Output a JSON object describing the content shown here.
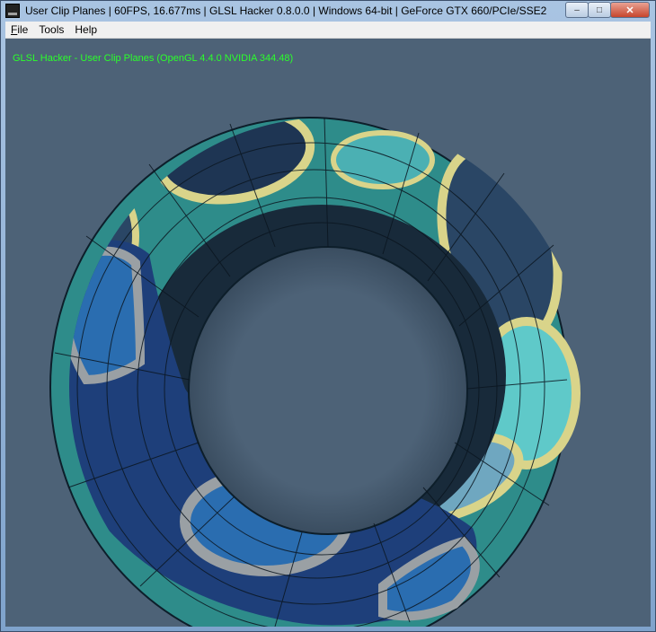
{
  "window": {
    "title": "User Clip Planes | 60FPS, 16.677ms | GLSL Hacker 0.8.0.0 | Windows 64-bit | GeForce GTX 660/PCIe/SSE2",
    "controls": {
      "minimize": "–",
      "maximize": "□",
      "close": "✕"
    }
  },
  "menu": {
    "file_first": "F",
    "file_rest": "ile",
    "tools": "Tools",
    "help": "Help"
  },
  "viewport": {
    "overlay_text": "GLSL Hacker - User Clip Planes (OpenGL 4.4.0 NVIDIA 344.48)",
    "background": "#4d6277",
    "overlay_color": "#2bff2b"
  },
  "scene": {
    "object": "torus-mesh",
    "colors": {
      "teal": "#2e8c8a",
      "teal_light": "#5fc9c9",
      "yellow_ring": "#d9d48a",
      "navy_patch": "#1e3553",
      "inner_dark": "#162434",
      "blue_section": "#1e3f7a",
      "blue_light": "#2a6db0",
      "grey_ring": "#9aa0a4"
    }
  }
}
